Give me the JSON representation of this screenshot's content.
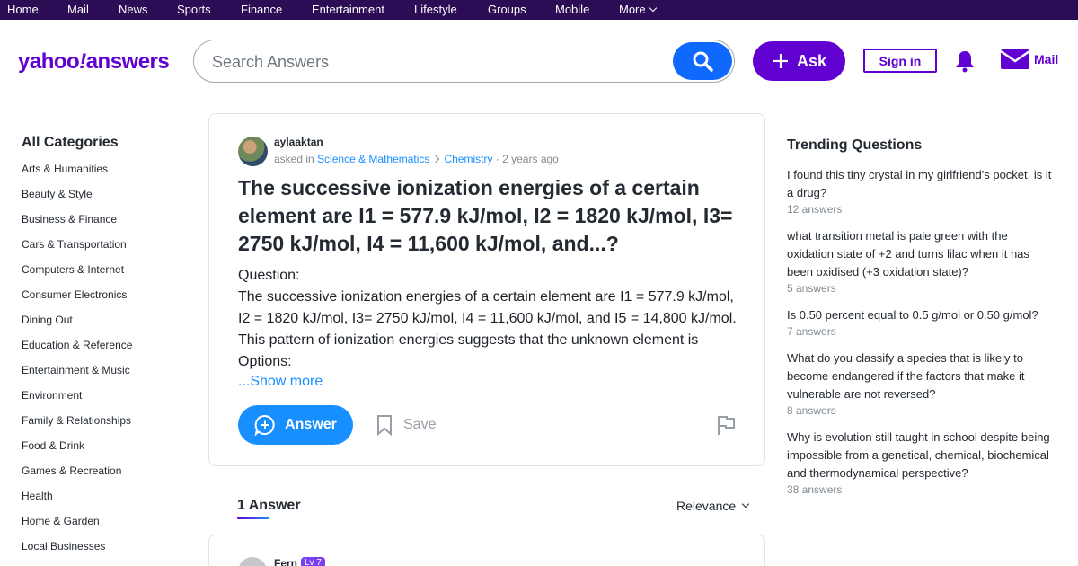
{
  "topnav": {
    "items": [
      "Home",
      "Mail",
      "News",
      "Sports",
      "Finance",
      "Entertainment",
      "Lifestyle",
      "Groups",
      "Mobile",
      "More"
    ]
  },
  "header": {
    "logo_text": "yahoo",
    "logo_excl": "!",
    "logo_sub": "answers",
    "search_placeholder": "Search Answers",
    "ask_label": "Ask",
    "signin_label": "Sign in",
    "mail_label": "Mail"
  },
  "sidebar": {
    "title": "All Categories",
    "categories": [
      "Arts & Humanities",
      "Beauty & Style",
      "Business & Finance",
      "Cars & Transportation",
      "Computers & Internet",
      "Consumer Electronics",
      "Dining Out",
      "Education & Reference",
      "Entertainment & Music",
      "Environment",
      "Family & Relationships",
      "Food & Drink",
      "Games & Recreation",
      "Health",
      "Home & Garden",
      "Local Businesses"
    ]
  },
  "question": {
    "username": "aylaaktan",
    "asked_in": "asked in",
    "category": "Science & Mathematics",
    "subcategory": "Chemistry",
    "time": "· 2 years ago",
    "title": "The successive ionization energies of a certain element are I1 = 577.9 kJ/mol, I2 = 1820 kJ/mol, I3= 2750 kJ/mol, I4 = 11,600 kJ/mol, and...?",
    "body_label": "Question:",
    "body": "The successive ionization energies of a certain element are I1 = 577.9 kJ/mol, I2 = 1820 kJ/mol, I3= 2750 kJ/mol, I4 = 11,600 kJ/mol, and I5 = 14,800 kJ/mol. This pattern of ionization energies suggests that the unknown element is",
    "body_options": "Options:",
    "show_more": "...Show more",
    "answer_label": "Answer",
    "save_label": "Save"
  },
  "answers": {
    "count_label": "1 Answer",
    "sort_label": "Relevance",
    "first_user": "Fern",
    "first_level": "Lv 7"
  },
  "trending": {
    "title": "Trending Questions",
    "items": [
      {
        "q": "I found this tiny crystal in my girlfriend's pocket, is it a drug?",
        "a": "12 answers"
      },
      {
        "q": "what transition metal is pale green with the oxidation state of +2 and turns lilac when it has been oxidised (+3 oxidation state)?",
        "a": "5 answers"
      },
      {
        "q": "Is 0.50 percent equal to 0.5 g/mol or 0.50 g/mol?",
        "a": "7 answers"
      },
      {
        "q": "What do you classify a species that is likely to become endangered if the factors that make it vulnerable are not reversed?",
        "a": "8 answers"
      },
      {
        "q": "Why is evolution still taught in school despite being impossible from a genetical, chemical, biochemical and thermodynamical perspective?",
        "a": "38 answers"
      }
    ]
  },
  "colors": {
    "brand_purple": "#6001d2",
    "nav_bg": "#2c0c54",
    "accent_blue": "#188fff"
  }
}
